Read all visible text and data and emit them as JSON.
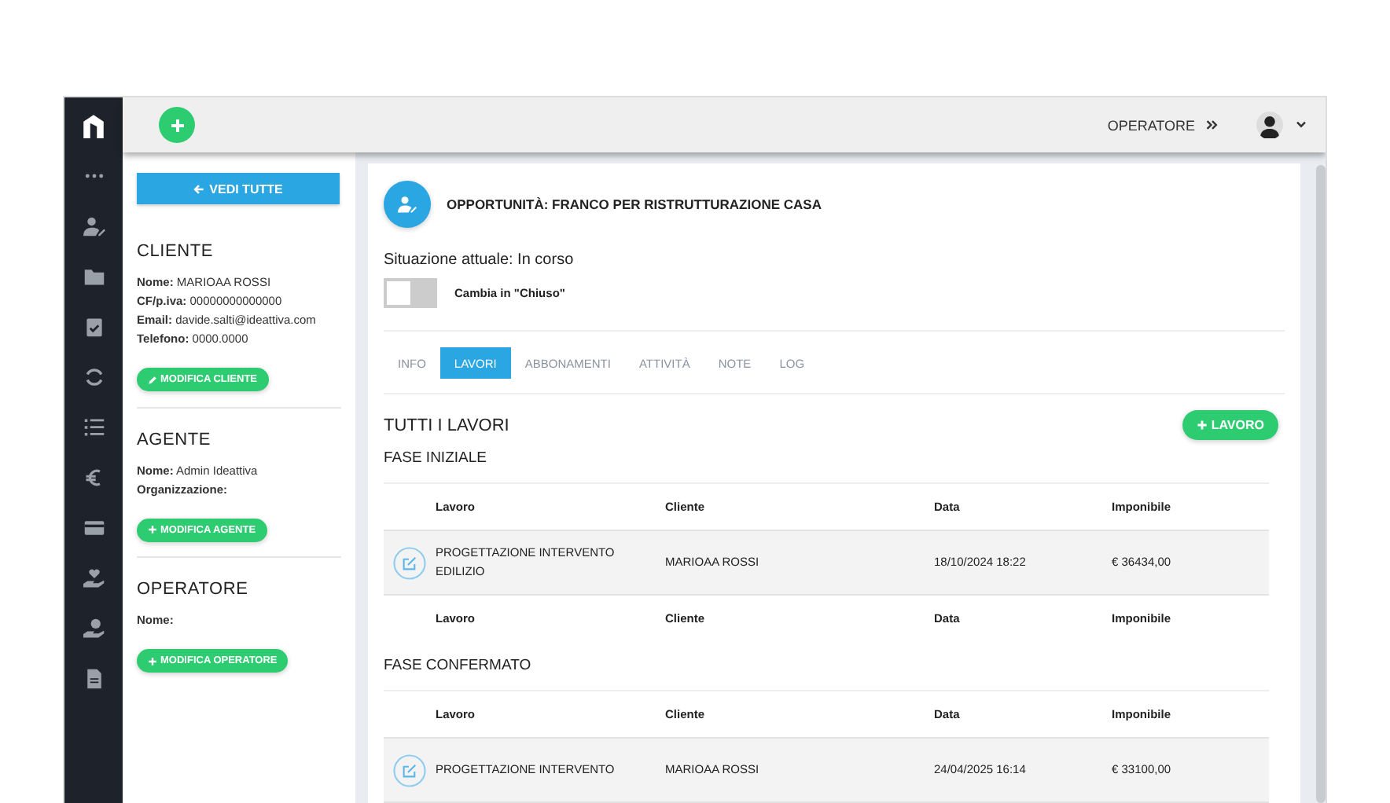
{
  "topbar": {
    "role_label": "OPERATORE"
  },
  "left_panel": {
    "back_button": "VEDI TUTTE",
    "sections": [
      {
        "title": "CLIENTE",
        "fields": [
          {
            "label": "Nome:",
            "value": "MARIOAA ROSSI"
          },
          {
            "label": "CF/p.iva:",
            "value": "00000000000000"
          },
          {
            "label": "Email:",
            "value": "davide.salti@ideattiva.com"
          },
          {
            "label": "Telefono:",
            "value": "0000.0000"
          }
        ],
        "button": {
          "kind": "edit",
          "label": "MODIFICA CLIENTE"
        }
      },
      {
        "title": "AGENTE",
        "fields": [
          {
            "label": "Nome:",
            "value": "Admin Ideattiva"
          },
          {
            "label": "Organizzazione:"
          }
        ],
        "button": {
          "kind": "add",
          "label": "MODIFICA AGENTE"
        }
      },
      {
        "title": "OPERATORE",
        "fields": [
          {
            "label": "Nome:"
          }
        ],
        "button": {
          "kind": "add",
          "label": "MODIFICA OPERATORE"
        }
      }
    ]
  },
  "main": {
    "title": "OPPORTUNITÀ: FRANCO PER RISTRUTTURAZIONE CASA",
    "status": "Situazione attuale: In corso",
    "toggle": {
      "on": false,
      "label": "Cambia in \"Chiuso\""
    },
    "tabs": [
      {
        "label": "INFO",
        "selected": false
      },
      {
        "label": "LAVORI",
        "selected": true
      },
      {
        "label": "ABBONAMENTI",
        "selected": false
      },
      {
        "label": "ATTIVITÀ",
        "selected": false
      },
      {
        "label": "NOTE",
        "selected": false
      },
      {
        "label": "LOG",
        "selected": false
      }
    ],
    "section_title": "TUTTI I LAVORI",
    "add_button": "LAVORO",
    "phases": [
      {
        "title": "FASE INIZIALE",
        "columns": [
          "Lavoro",
          "Cliente",
          "Data",
          "Imponibile"
        ],
        "rows": [
          [
            "PROGETTAZIONE INTERVENTO EDILIZIO",
            "MARIOAA ROSSI",
            "18/10/2024 18:22",
            "€ 36434,00"
          ]
        ],
        "footer_columns": [
          "Lavoro",
          "Cliente",
          "Data",
          "Imponibile"
        ]
      },
      {
        "title": "FASE CONFERMATO",
        "columns": [
          "Lavoro",
          "Cliente",
          "Data",
          "Imponibile"
        ],
        "rows": [
          [
            "PROGETTAZIONE INTERVENTO",
            "MARIOAA ROSSI",
            "24/04/2025 16:14",
            "€ 33100,00"
          ]
        ]
      }
    ]
  }
}
